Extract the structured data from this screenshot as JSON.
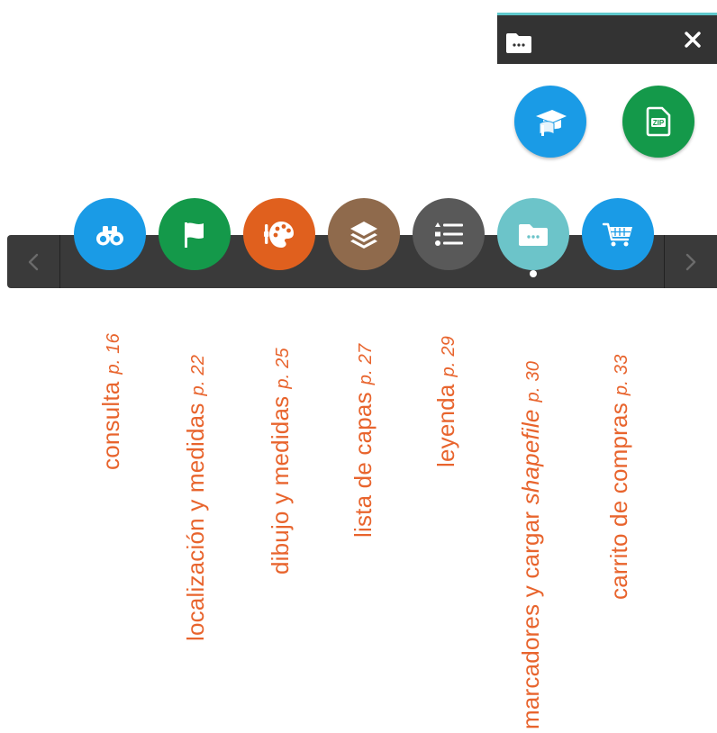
{
  "panel": {
    "folder_icon": "folder-dots-icon",
    "close_icon": "close-icon",
    "accent_color": "#5fc8cc",
    "buttons": [
      {
        "name": "tutorial-button",
        "icon": "graduation-cap-book-icon",
        "color": "#1a9be6"
      },
      {
        "name": "zip-download-button",
        "icon": "zip-file-icon",
        "color": "#14994a"
      }
    ]
  },
  "toolbar": {
    "prev_icon": "chevron-left-icon",
    "next_icon": "chevron-right-icon",
    "tools": [
      {
        "name": "consulta",
        "icon": "binoculars-icon",
        "color": "#1a9be6"
      },
      {
        "name": "localizacion",
        "icon": "flag-icon",
        "color": "#14994a"
      },
      {
        "name": "dibujo",
        "icon": "palette-icon",
        "color": "#e0601e"
      },
      {
        "name": "capas",
        "icon": "layers-icon",
        "color": "#8f6a4c"
      },
      {
        "name": "leyenda",
        "icon": "list-icon",
        "color": "#595959"
      },
      {
        "name": "marcadores",
        "icon": "folder-dots-icon",
        "color": "#6cc4c9",
        "active": true
      },
      {
        "name": "carrito",
        "icon": "shopping-cart-icon",
        "color": "#1a9be6"
      }
    ]
  },
  "labels": {
    "consulta": {
      "text": "consulta",
      "page": "p. 16"
    },
    "localizacion": {
      "text": "localización y medidas",
      "page": "p. 22"
    },
    "dibujo": {
      "text": "dibujo y medidas",
      "page": "p. 25"
    },
    "capas": {
      "text": "lista de capas",
      "page": "p. 27"
    },
    "leyenda": {
      "text": "leyenda",
      "page": "p. 29"
    },
    "marcadores": {
      "text": "marcadores y cargar ",
      "em": "shapefile",
      "page": "p. 30"
    },
    "carrito": {
      "text": "carrito de compras",
      "page": "p. 33"
    }
  },
  "label_color": "#e8642d"
}
